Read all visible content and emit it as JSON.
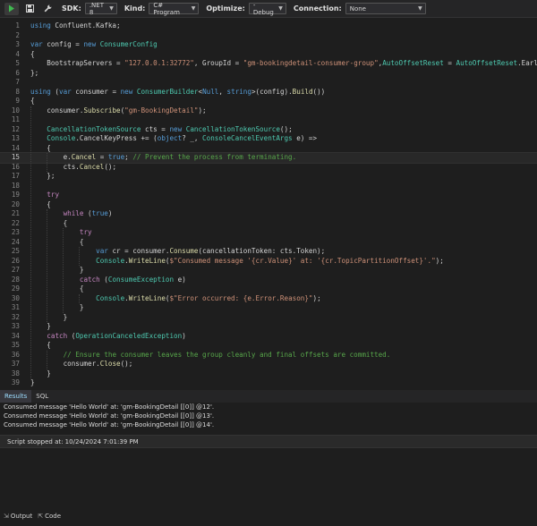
{
  "toolbar": {
    "sdk_label": "SDK:",
    "sdk_value": ".NET 8",
    "kind_label": "Kind:",
    "kind_value": "C# Program",
    "optimize_label": "Optimize:",
    "optimize_value": "- Debug",
    "connection_label": "Connection:",
    "connection_value": "None",
    "icons": [
      "run-icon",
      "save-icon",
      "wrench-icon"
    ]
  },
  "editor": {
    "current_line": 15,
    "lines": [
      {
        "n": "1",
        "t": "using Confluent.Kafka;"
      },
      {
        "n": "2",
        "t": ""
      },
      {
        "n": "3",
        "t": "var config = new ConsumerConfig"
      },
      {
        "n": "4",
        "t": "{"
      },
      {
        "n": "5",
        "t": "    BootstrapServers = \"127.0.0.1:32772\", GroupId = \"gm-bookingdetail-consumer-group\",AutoOffsetReset = AutoOffsetReset.Earliest"
      },
      {
        "n": "6",
        "t": "};"
      },
      {
        "n": "7",
        "t": ""
      },
      {
        "n": "8",
        "t": "using (var consumer = new ConsumerBuilder<Null, string>(config).Build())"
      },
      {
        "n": "9",
        "t": "{"
      },
      {
        "n": "10",
        "t": "    consumer.Subscribe(\"gm-BookingDetail\");"
      },
      {
        "n": "11",
        "t": ""
      },
      {
        "n": "12",
        "t": "    CancellationTokenSource cts = new CancellationTokenSource();"
      },
      {
        "n": "13",
        "t": "    Console.CancelKeyPress += (object? _, ConsoleCancelEventArgs e) =>"
      },
      {
        "n": "14",
        "t": "    {"
      },
      {
        "n": "15",
        "t": "        e.Cancel = true; // Prevent the process from terminating."
      },
      {
        "n": "16",
        "t": "        cts.Cancel();"
      },
      {
        "n": "17",
        "t": "    };"
      },
      {
        "n": "18",
        "t": ""
      },
      {
        "n": "19",
        "t": "    try"
      },
      {
        "n": "20",
        "t": "    {"
      },
      {
        "n": "21",
        "t": "        while (true)"
      },
      {
        "n": "22",
        "t": "        {"
      },
      {
        "n": "23",
        "t": "            try"
      },
      {
        "n": "24",
        "t": "            {"
      },
      {
        "n": "25",
        "t": "                var cr = consumer.Consume(cancellationToken: cts.Token);"
      },
      {
        "n": "26",
        "t": "                Console.WriteLine($\"Consumed message '{cr.Value}' at: '{cr.TopicPartitionOffset}'.\");"
      },
      {
        "n": "27",
        "t": "            }"
      },
      {
        "n": "28",
        "t": "            catch (ConsumeException e)"
      },
      {
        "n": "29",
        "t": "            {"
      },
      {
        "n": "30",
        "t": "                Console.WriteLine($\"Error occurred: {e.Error.Reason}\");"
      },
      {
        "n": "31",
        "t": "            }"
      },
      {
        "n": "32",
        "t": "        }"
      },
      {
        "n": "33",
        "t": "    }"
      },
      {
        "n": "34",
        "t": "    catch (OperationCanceledException)"
      },
      {
        "n": "35",
        "t": "    {"
      },
      {
        "n": "36",
        "t": "        // Ensure the consumer leaves the group cleanly and final offsets are committed."
      },
      {
        "n": "37",
        "t": "        consumer.Close();"
      },
      {
        "n": "38",
        "t": "    }"
      },
      {
        "n": "39",
        "t": "}"
      }
    ]
  },
  "results": {
    "tabs": [
      "Results",
      "SQL"
    ],
    "active_tab": "Results",
    "lines": [
      "Consumed message 'Hello World' at: 'gm-BookingDetail [[0]] @12'.",
      "Consumed message 'Hello World' at: 'gm-BookingDetail [[0]] @13'.",
      "Consumed message 'Hello World' at: 'gm-BookingDetail [[0]] @14'."
    ],
    "status": "Script stopped at: 10/24/2024 7:01:39 PM"
  },
  "bottom": {
    "output_label": "Output",
    "code_label": "Code"
  },
  "colors": {
    "background": "#1e1e1e",
    "keyword": "#569cd6",
    "type": "#4ec9b0",
    "string": "#ce9178",
    "comment": "#57a64a"
  }
}
